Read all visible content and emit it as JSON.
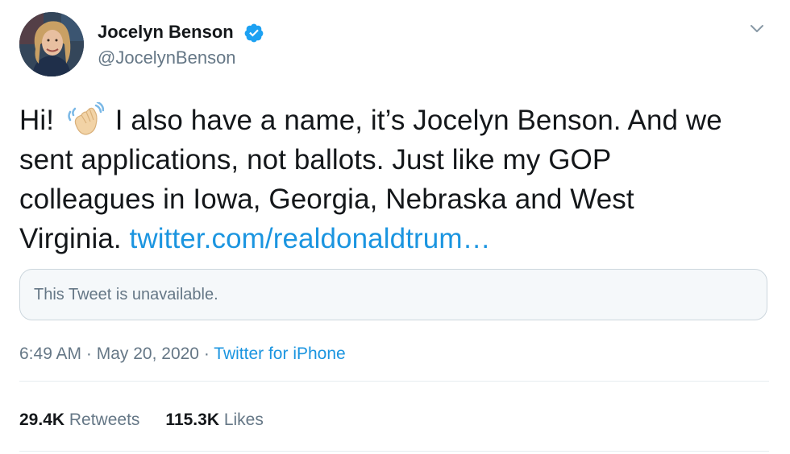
{
  "author": {
    "name": "Jocelyn Benson",
    "handle": "@JocelynBenson"
  },
  "tweet": {
    "line1_a": "Hi! ",
    "line1_b": " I also have a name, it’s Jocelyn Benson. And we",
    "line2": "sent applications, not ballots. Just like my GOP",
    "line3": "colleagues in Iowa, Georgia, Nebraska and West",
    "line4": "Virginia. ",
    "link": "twitter.com/realdonaldtrum…"
  },
  "quoted": {
    "text": "This Tweet is unavailable."
  },
  "meta": {
    "time": "6:49 AM",
    "sep1": " · ",
    "date": "May 20, 2020",
    "sep2": " · ",
    "source": "Twitter for iPhone"
  },
  "stats": {
    "retweets_count": "29.4K",
    "retweets_label": " Retweets",
    "likes_count": "115.3K",
    "likes_label": " Likes"
  },
  "icons": {
    "verified": "verified-badge-icon",
    "menu": "chevron-down-icon",
    "emoji": "waving-hand-icon"
  },
  "colors": {
    "link": "#1b95e0",
    "verified": "#1da1f2",
    "muted": "#657786",
    "text": "#14171a"
  }
}
